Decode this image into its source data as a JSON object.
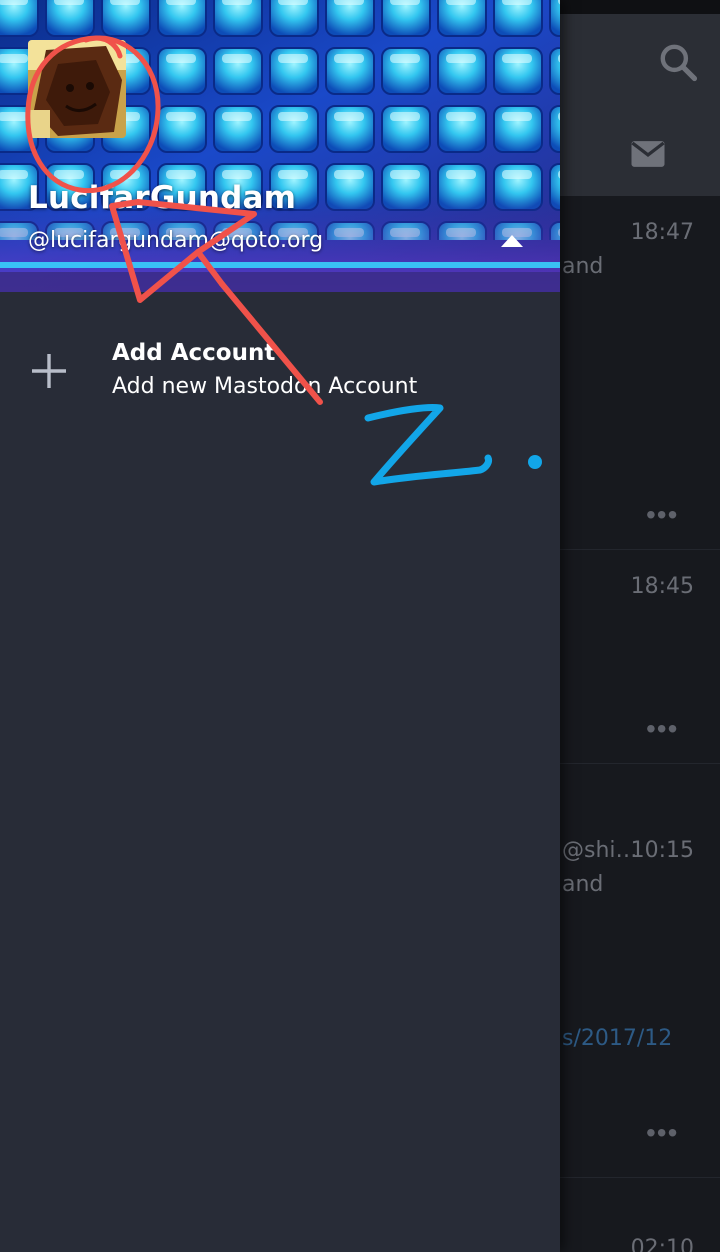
{
  "drawer": {
    "account": {
      "display_name": "LucifarGundam",
      "handle": "@lucifargundam@qoto.org",
      "avatar_icon": "avatar-image",
      "toggle_icon": "triangle-up-icon"
    },
    "add_account": {
      "icon": "plus-icon",
      "title": "Add Account",
      "subtitle": "Add new Mastodon Account"
    }
  },
  "background": {
    "toolbar_icons": [
      "search-icon",
      "mail-icon"
    ],
    "posts": [
      {
        "time": "18:47",
        "fragments": [
          "and"
        ]
      },
      {
        "time": "18:45",
        "fragments": []
      },
      {
        "time": "10:15",
        "fragments": [
          "@shi…",
          "and",
          "s/2017/12"
        ]
      },
      {
        "time": "02:10",
        "fragments": []
      }
    ]
  },
  "annotation": {
    "handwritten_text": "2.",
    "colors": {
      "red": "#f0524a",
      "blue": "#12a6e8"
    }
  },
  "colors": {
    "drawer_bg": "#282c37",
    "screen_bg": "#17191e",
    "text_primary": "#ffffff",
    "text_muted": "#6a6d75",
    "link_dim": "#2d5a85"
  }
}
